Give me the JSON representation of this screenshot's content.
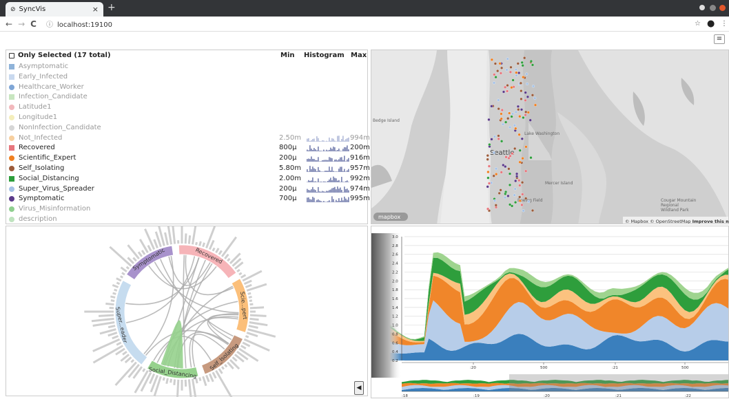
{
  "browser": {
    "tab_title": "SyncVis",
    "tab_close": "×",
    "new_tab": "+",
    "url": "localhost:19100"
  },
  "legend": {
    "header": {
      "title": "Only Selected (17 total)",
      "min": "Min",
      "histogram": "Histogram",
      "max": "Max"
    },
    "items": [
      {
        "label": "Asymptomatic",
        "color": "#8fb3d9",
        "shape": "square",
        "active": false,
        "min": "",
        "max": ""
      },
      {
        "label": "Early_Infected",
        "color": "#c9d9ef",
        "shape": "square",
        "active": false,
        "min": "",
        "max": ""
      },
      {
        "label": "Healthcare_Worker",
        "color": "#7fa6d6",
        "shape": "circle",
        "active": false,
        "min": "",
        "max": ""
      },
      {
        "label": "Infection_Candidate",
        "color": "#c8e6c0",
        "shape": "square",
        "active": false,
        "min": "",
        "max": ""
      },
      {
        "label": "Latitude1",
        "color": "#f2b8bc",
        "shape": "circle",
        "active": false,
        "min": "",
        "max": ""
      },
      {
        "label": "Longitude1",
        "color": "#f4eebb",
        "shape": "circle",
        "active": false,
        "min": "",
        "max": ""
      },
      {
        "label": "NonInfection_Candidate",
        "color": "#d6d6d6",
        "shape": "circle",
        "active": false,
        "min": "",
        "max": ""
      },
      {
        "label": "Not_Infected",
        "color": "#f7cf9f",
        "shape": "circle",
        "active": false,
        "min": "2.50m",
        "max": "994m"
      },
      {
        "label": "Recovered",
        "color": "#e7767d",
        "shape": "square",
        "active": true,
        "min": "800µ",
        "max": "200m"
      },
      {
        "label": "Scientific_Expert",
        "color": "#f07f20",
        "shape": "circle",
        "active": true,
        "min": "200µ",
        "max": "916m"
      },
      {
        "label": "Self_Isolating",
        "color": "#9c5b3a",
        "shape": "circle",
        "active": true,
        "min": "5.80m",
        "max": "957m"
      },
      {
        "label": "Social_Distancing",
        "color": "#2e9e3c",
        "shape": "square",
        "active": true,
        "min": "2.00m",
        "max": "992m"
      },
      {
        "label": "Super_Virus_Spreader",
        "color": "#a6c2e6",
        "shape": "circle",
        "active": true,
        "min": "200µ",
        "max": "974m"
      },
      {
        "label": "Symptomatic",
        "color": "#5b3a8a",
        "shape": "circle",
        "active": true,
        "min": "700µ",
        "max": "995m"
      },
      {
        "label": "Virus_Misinformation",
        "color": "#8fcf8f",
        "shape": "circle",
        "active": false,
        "min": "",
        "max": ""
      },
      {
        "label": "description",
        "color": "#bfe3bf",
        "shape": "circle",
        "active": false,
        "min": "",
        "max": ""
      }
    ]
  },
  "map": {
    "labels": [
      "Seattle",
      "Lake Washington",
      "Mercer Island",
      "Bedge Island",
      "Boeing Field",
      "Cougar Mountain Regional Wildland Park"
    ],
    "attribution": "© Mapbox © OpenStreetMap",
    "improve": "Improve this map",
    "logo": "mapbox"
  },
  "chord": {
    "groups": [
      {
        "label": "Symptomatic",
        "color": "#a892cc"
      },
      {
        "label": "Recovered",
        "color": "#f6b4b8"
      },
      {
        "label": "Scie...pert",
        "color": "#fbbf7a"
      },
      {
        "label": "Self_Isolating",
        "color": "#c79a7f"
      },
      {
        "label": "Social_Distancing",
        "color": "#96d18d"
      },
      {
        "label": "Super...eader",
        "color": "#c6dcef"
      }
    ],
    "collapse_button": "◀"
  },
  "stream": {
    "y_ticks": [
      "3.0",
      "2.8",
      "2.6",
      "2.4",
      "2.2",
      "2.0",
      "1.8",
      "1.6",
      "1.4",
      "1.2",
      "1.0",
      "0.8",
      "0.6",
      "0.4",
      "0.2"
    ],
    "x_ticks": [
      ":20",
      "500",
      ":21",
      "500"
    ],
    "brush_ticks": [
      ":18",
      ":19",
      ":20",
      ":21",
      ":22"
    ],
    "colors": {
      "blue_dark": "#3a7fbd",
      "blue_light": "#b7cde9",
      "orange": "#f0862a",
      "orange_light": "#fbc27f",
      "green": "#2e9e3c",
      "green_light": "#9fd48f"
    }
  }
}
